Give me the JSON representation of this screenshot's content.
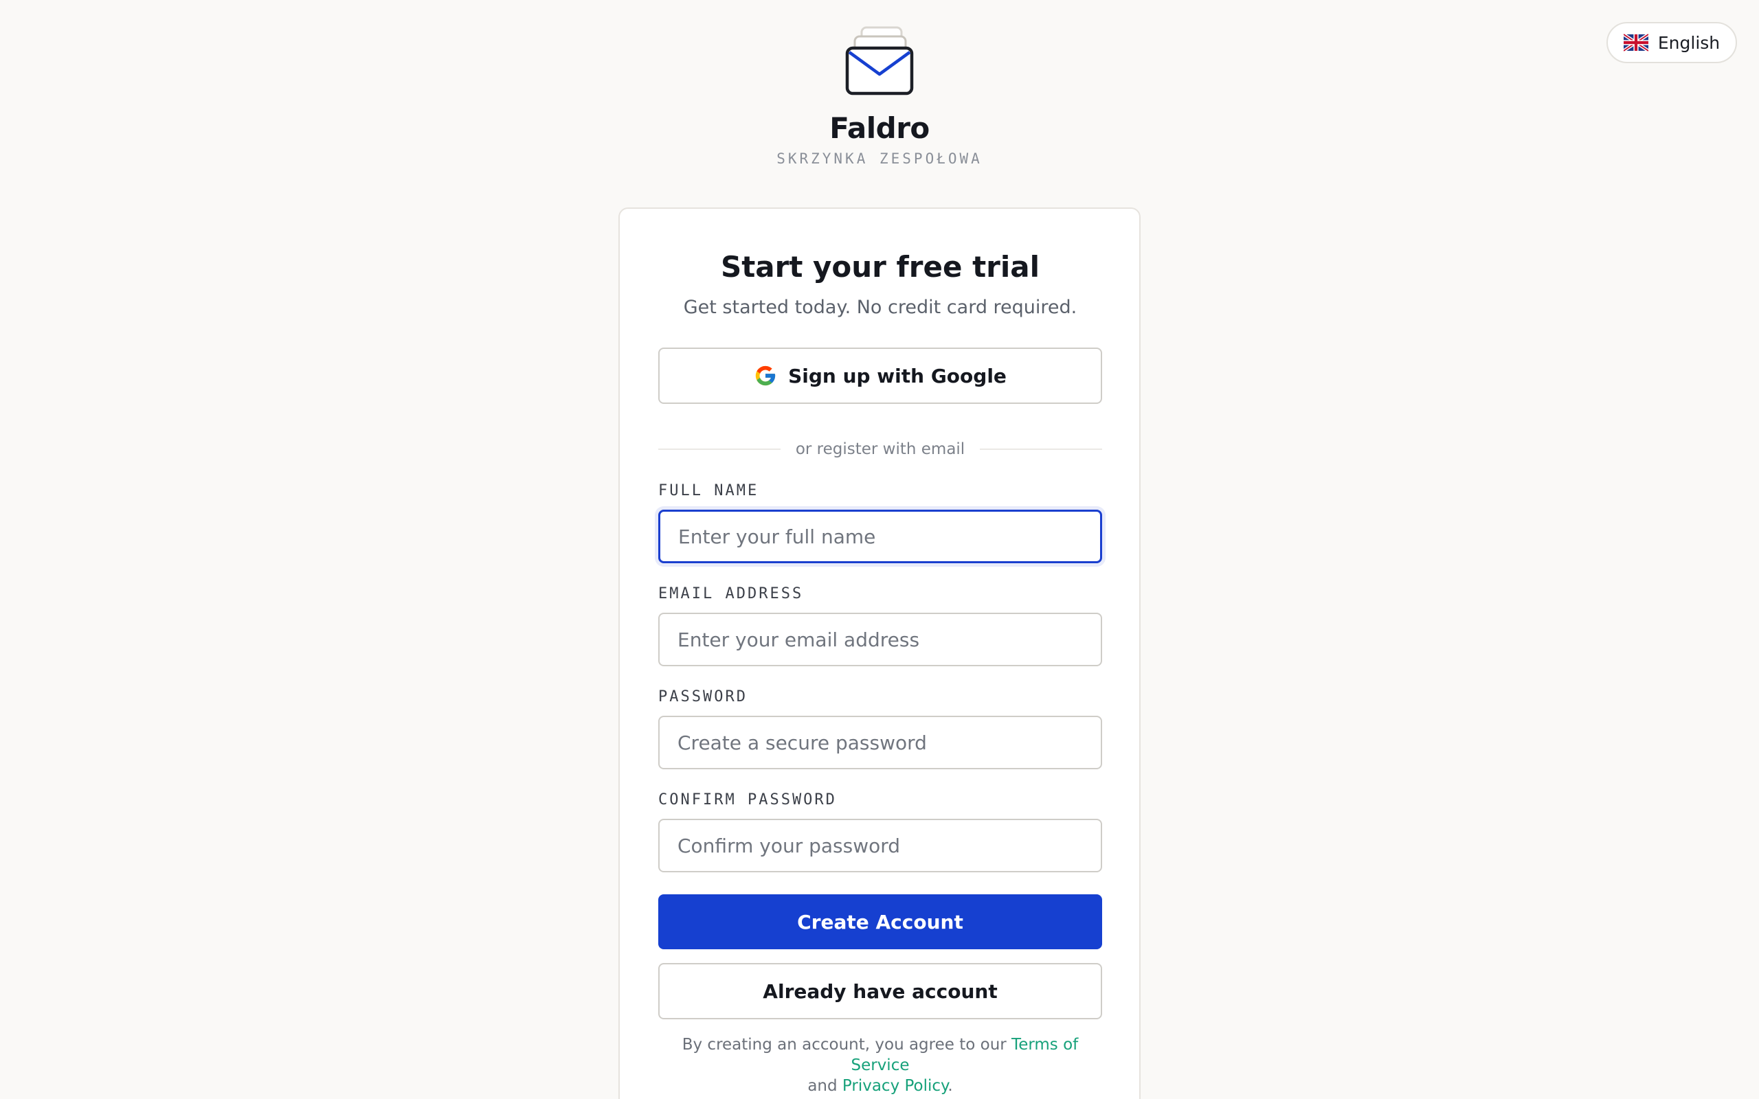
{
  "language": {
    "flag_icon": "uk-flag-icon",
    "label": "English"
  },
  "brand": {
    "logo_icon": "stacked-mail-icon",
    "name": "Faldro",
    "tagline": "SKRZYNKA ZESPOŁOWA"
  },
  "signup": {
    "title": "Start your free trial",
    "subtitle": "Get started today. No credit card required.",
    "google_button": {
      "icon": "google-icon",
      "label": "Sign up with Google"
    },
    "divider_text": "or register with email",
    "fields": {
      "full_name": {
        "label": "FULL NAME",
        "value": "",
        "placeholder": "Enter your full name",
        "focused": true
      },
      "email": {
        "label": "EMAIL ADDRESS",
        "value": "",
        "placeholder": "Enter your email address"
      },
      "password": {
        "label": "PASSWORD",
        "value": "",
        "placeholder": "Create a secure password"
      },
      "confirm_password": {
        "label": "CONFIRM PASSWORD",
        "value": "",
        "placeholder": "Confirm your password"
      }
    },
    "create_button_label": "Create Account",
    "login_button_label": "Already have account",
    "legal": {
      "prefix": "By creating an account, you agree to our ",
      "terms_link": "Terms of Service",
      "middle": "and ",
      "privacy_link": "Privacy Policy",
      "suffix": "."
    }
  },
  "colors": {
    "background": "#faf9f7",
    "primary": "#1640d0",
    "link": "#17a17a",
    "focus_border": "#1a3fcf"
  }
}
